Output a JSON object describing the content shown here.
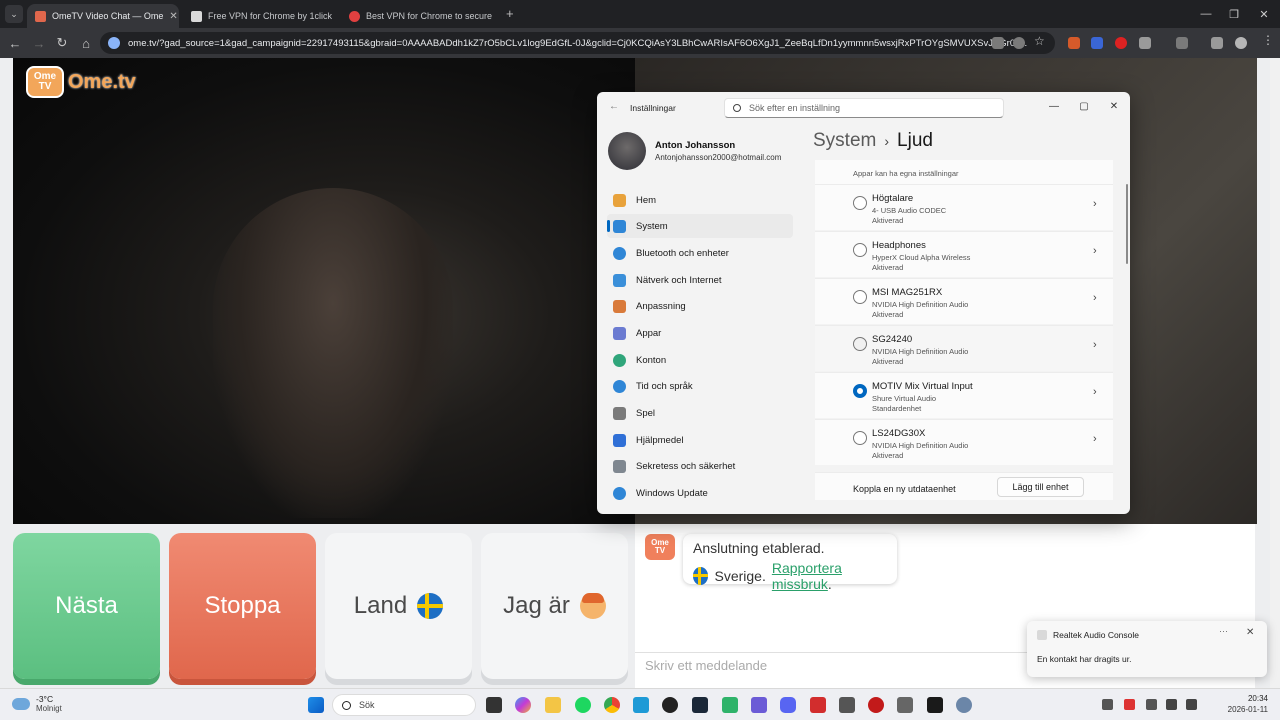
{
  "browser": {
    "tabs": [
      {
        "title": "OmeTV Video Chat — Ome",
        "favicon_color": "#e0674c",
        "active": true
      },
      {
        "title": "Free VPN for Chrome by 1click",
        "favicon_color": "#d9d9d9",
        "active": false
      },
      {
        "title": "Best VPN for Chrome to secure",
        "favicon_color": "#e04040",
        "active": false
      }
    ],
    "new_tab_label": "+",
    "url": "ome.tv/?gad_source=1&gad_campaignid=22917493115&gbraid=0AAAABADdh1kZ7rO5bCLv1log9EdGfL-0J&gclid=Cj0KCQiAsY3LBhCwARIsAF6O6XgJ1_ZeeBqLfDn1yymmnn5wsxjRxPTrOYgSMVUXSvJAGr0v..."
  },
  "ometv": {
    "logo_badge": "Ome TV",
    "logo_text": "Ome.tv",
    "buttons": {
      "next": "Nästa",
      "stop": "Stoppa",
      "country": "Land",
      "i_am": "Jag är"
    },
    "chat": {
      "logo": "Ome TV",
      "status": "Anslutning etablerad.",
      "country": "Sverige.",
      "report_link": "Rapportera missbruk",
      "report_suffix": ".",
      "input_placeholder": "Skriv ett meddelande"
    }
  },
  "settings": {
    "title": "Inställningar",
    "search_placeholder": "Sök efter en inställning",
    "user": {
      "name": "Anton Johansson",
      "email": "Antonjohansson2000@hotmail.com"
    },
    "nav": [
      {
        "label": "Hem",
        "icon": "home-icon",
        "color": "#e8a23b"
      },
      {
        "label": "System",
        "icon": "system-icon",
        "color": "#2f86d6",
        "selected": true
      },
      {
        "label": "Bluetooth och enheter",
        "icon": "bluetooth-icon",
        "color": "#2f86d6"
      },
      {
        "label": "Nätverk och Internet",
        "icon": "network-icon",
        "color": "#3a8fd9"
      },
      {
        "label": "Anpassning",
        "icon": "brush-icon",
        "color": "#d97a3a"
      },
      {
        "label": "Appar",
        "icon": "apps-icon",
        "color": "#6b7bd1"
      },
      {
        "label": "Konton",
        "icon": "account-icon",
        "color": "#2fa57a"
      },
      {
        "label": "Tid och språk",
        "icon": "globe-icon",
        "color": "#2f86d6"
      },
      {
        "label": "Spel",
        "icon": "gamepad-icon",
        "color": "#7a7a7a"
      },
      {
        "label": "Hjälpmedel",
        "icon": "accessibility-icon",
        "color": "#2f6fd6"
      },
      {
        "label": "Sekretess och säkerhet",
        "icon": "shield-icon",
        "color": "#7f8790"
      },
      {
        "label": "Windows Update",
        "icon": "update-icon",
        "color": "#2f86d6"
      }
    ],
    "breadcrumb": {
      "parent": "System",
      "separator": "›",
      "current": "Ljud"
    },
    "app_hint": "Appar kan ha egna inställningar",
    "devices": [
      {
        "name": "Högtalare",
        "desc": "4- USB Audio CODEC",
        "status": "Aktiverad",
        "selected": false
      },
      {
        "name": "Headphones",
        "desc": "HyperX Cloud Alpha Wireless",
        "status": "Aktiverad",
        "selected": false
      },
      {
        "name": "MSI MAG251RX",
        "desc": "NVIDIA High Definition Audio",
        "status": "Aktiverad",
        "selected": false
      },
      {
        "name": "SG24240",
        "desc": "NVIDIA High Definition Audio",
        "status": "Aktiverad",
        "selected": false
      },
      {
        "name": "MOTIV Mix Virtual Input",
        "desc": "Shure Virtual Audio",
        "status": "Standardenhet",
        "selected": true
      },
      {
        "name": "LS24DG30X",
        "desc": "NVIDIA High Definition Audio",
        "status": "Aktiverad",
        "selected": false
      }
    ],
    "connect_label": "Koppla en ny utdataenhet",
    "add_device": "Lägg till enhet"
  },
  "notification": {
    "app": "Realtek Audio Console",
    "body": "En kontakt har dragits ur.",
    "more": "···",
    "close": "✕"
  },
  "taskbar": {
    "temperature": "-3°C",
    "weather": "Molnigt",
    "search": "Sök",
    "time": "20:34",
    "date": "2026-01-11"
  }
}
